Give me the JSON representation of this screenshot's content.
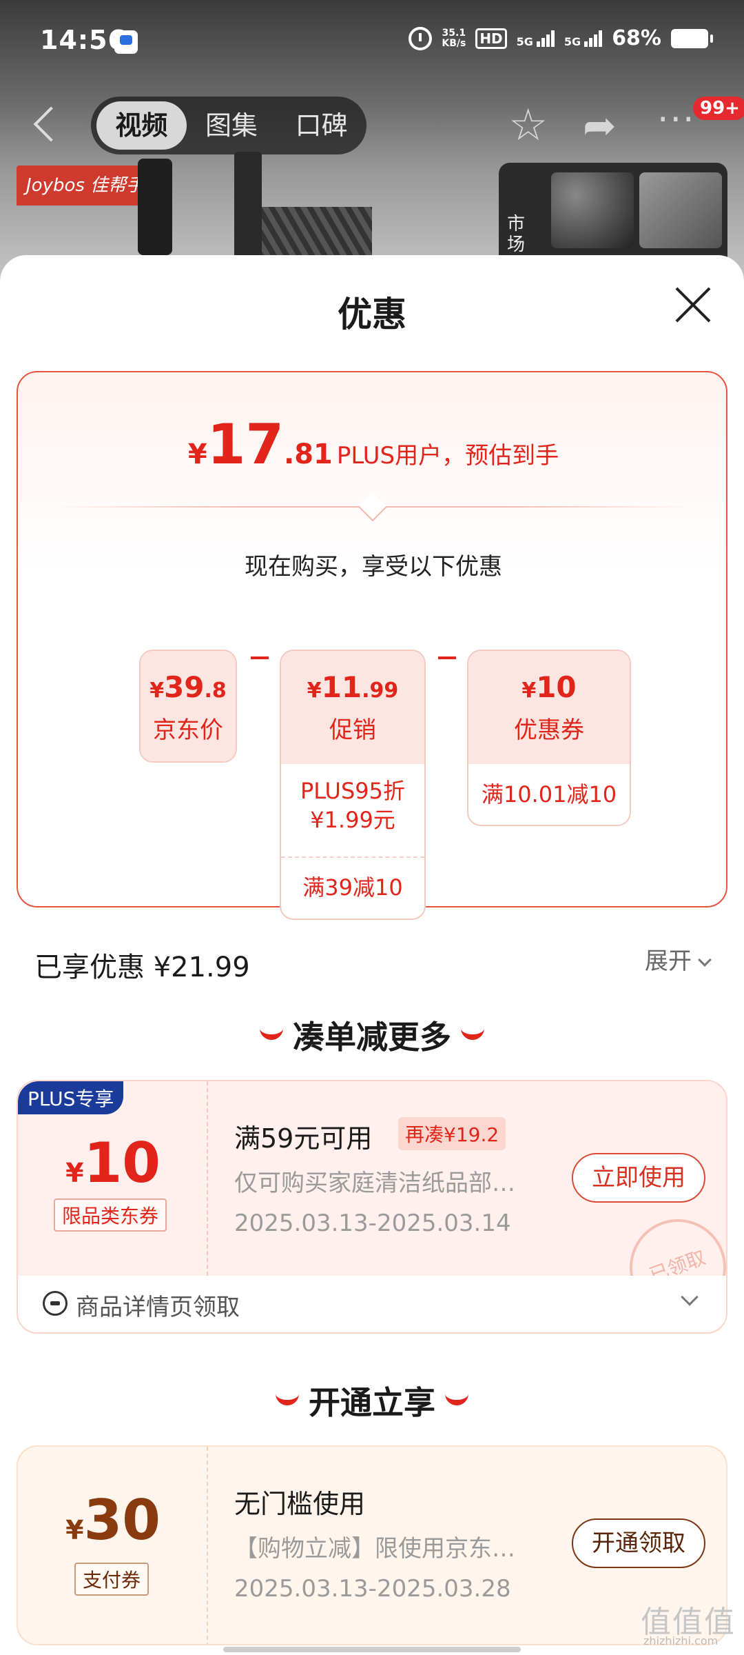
{
  "status_bar": {
    "time": "14:56",
    "net_speed_value": "35.1",
    "net_speed_unit": "KB/s",
    "hd": "HD",
    "sim1": "5G",
    "sim2": "5G",
    "battery": "68%"
  },
  "nav": {
    "tabs": [
      "视频",
      "图集",
      "口碑"
    ],
    "active_tab": "视频",
    "more_badge": "99+"
  },
  "product_bg": {
    "brand": "Joybos 佳帮手",
    "thumb_label": "市场"
  },
  "sheet": {
    "title": "优惠",
    "price": {
      "currency": "¥",
      "integer": "17",
      "decimal": ".81",
      "description": "PLUS用户，预估到手"
    },
    "subtitle": "现在购买，享受以下优惠",
    "breakdown": {
      "jd_price": {
        "currency": "¥",
        "integer": "39",
        "decimal": ".8",
        "label": "京东价"
      },
      "promo": {
        "currency": "¥",
        "integer": "11",
        "decimal": ".99",
        "label": "促销",
        "rows": [
          "PLUS95折¥1.99元",
          "满39减10"
        ]
      },
      "coupon": {
        "currency": "¥",
        "integer": "10",
        "decimal": "",
        "label": "优惠券",
        "rows": [
          "满10.01减10"
        ]
      }
    },
    "shared_discount": "已享优惠 ¥21.99",
    "expand_label": "展开",
    "section1_title": "凑单减更多",
    "coupon1": {
      "tag": "PLUS专享",
      "currency": "¥",
      "amount": "10",
      "type": "限品类东券",
      "title": "满59元可用",
      "extra": "再凑¥19.2",
      "description": "仅可购买家庭清洁纸品部…",
      "date_range": "2025.03.13-2025.03.14",
      "button": "立即使用",
      "stamp": "已领取",
      "footer": "商品详情页领取"
    },
    "section2_title": "开通立享",
    "coupon2": {
      "currency": "¥",
      "amount": "30",
      "type": "支付券",
      "title": "无门槛使用",
      "description": "【购物立减】限使用京东…",
      "date_range": "2025.03.13-2025.03.28",
      "button": "开通领取"
    }
  },
  "watermark": {
    "main": "值值值",
    "sub": "zhizhizhi.com"
  },
  "colors": {
    "accent_red": "#e1251b",
    "plus_blue": "#1b3b9a",
    "brown": "#8a3a0f"
  }
}
